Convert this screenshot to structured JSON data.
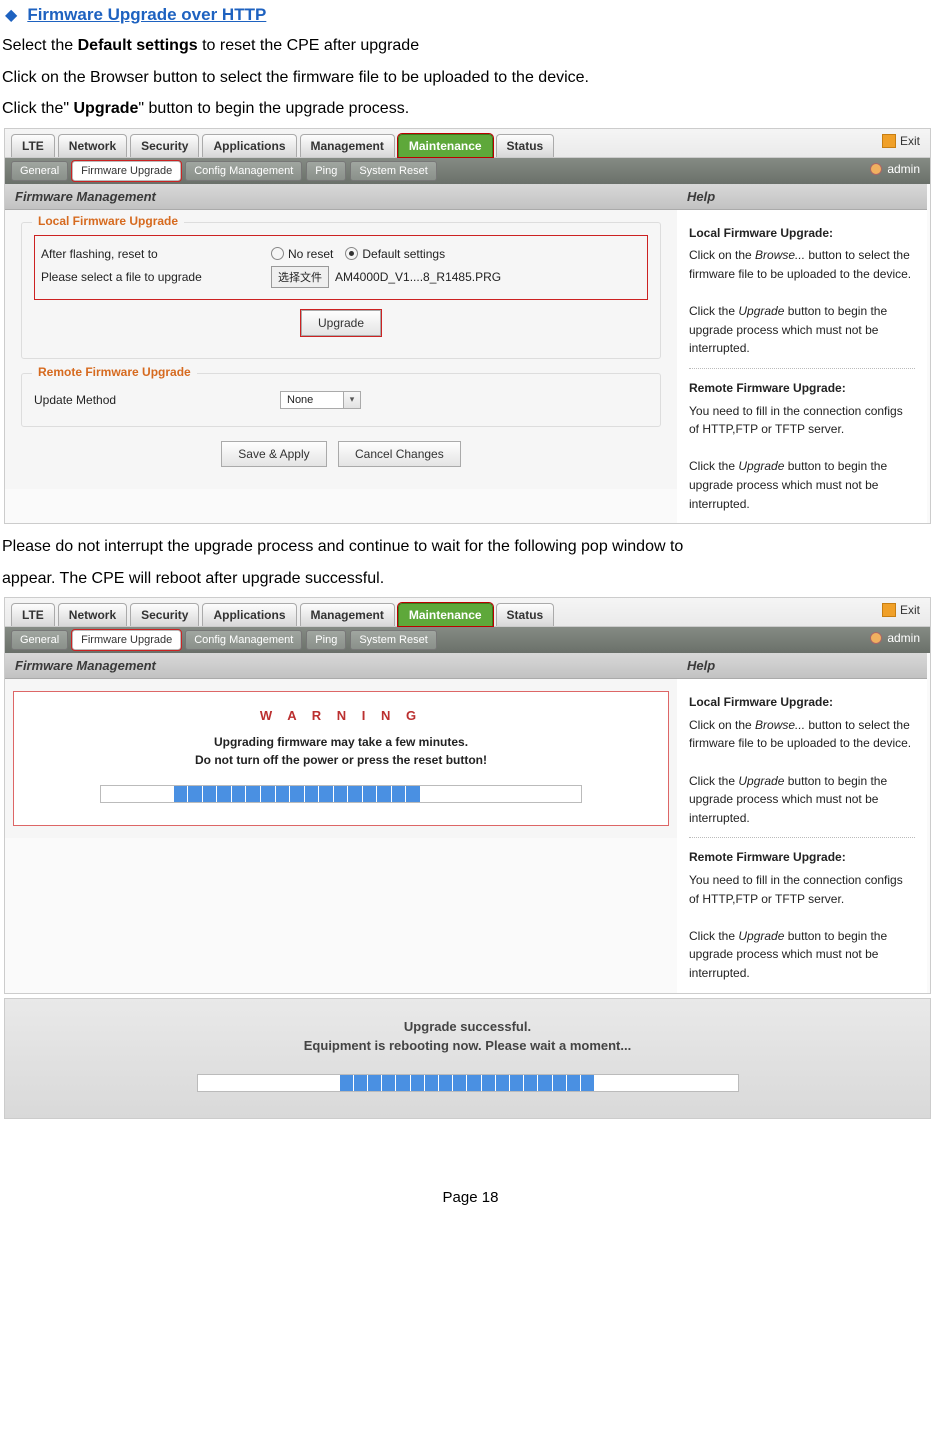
{
  "heading": {
    "title": "Firmware Upgrade over HTTP"
  },
  "doc": {
    "line1a": "Select the ",
    "line1b": "Default settings",
    "line1c": " to reset the CPE after upgrade",
    "line2": "Click on the Browser button to select the firmware file to be uploaded to the device.",
    "line3a": "Click the\" ",
    "line3b": "Upgrade",
    "line3c": "\" button to begin the upgrade process.",
    "mid1": "Please do not interrupt the upgrade process and continue to wait for the following pop window to",
    "mid2": "appear. The CPE will reboot after upgrade successful.",
    "page": "Page 18"
  },
  "main_tabs": [
    "LTE",
    "Network",
    "Security",
    "Applications",
    "Management",
    "Maintenance",
    "Status"
  ],
  "sub_tabs": [
    "General",
    "Firmware Upgrade",
    "Config Management",
    "Ping",
    "System Reset"
  ],
  "exit": "Exit",
  "user": "admin",
  "left_panel_title": "Firmware Management",
  "right_panel_title": "Help",
  "local": {
    "legend": "Local Firmware Upgrade",
    "row1": "After flashing, reset to",
    "row2": "Please select a file to upgrade",
    "opt1": "No reset",
    "opt2": "Default settings",
    "choose": "选择文件",
    "filename": "AM4000D_V1....8_R1485.PRG",
    "upgrade_btn": "Upgrade"
  },
  "remote": {
    "legend": "Remote Firmware Upgrade",
    "row1": "Update Method",
    "value": "None"
  },
  "savebtn": "Save & Apply",
  "cancelbtn": "Cancel Changes",
  "help": {
    "h1": "Local Firmware Upgrade:",
    "p1a": "Click on the ",
    "p1b": "Browse...",
    "p1c": " button to select the firmware file to be uploaded to the device.",
    "p2a": "Click the ",
    "p2b": "Upgrade",
    "p2c": " button to begin the upgrade process which must not be interrupted.",
    "h2": "Remote Firmware Upgrade:",
    "p3": "You need to fill in the connection configs of HTTP,FTP or TFTP server.",
    "p4a": "Click the ",
    "p4b": "Upgrade",
    "p4c": " button to begin the upgrade process which must not be interrupted."
  },
  "warn": {
    "title": "W A R N I N G",
    "l1": "Upgrading firmware may take a few minutes.",
    "l2": "Do not turn off the power or press the reset button!"
  },
  "success": {
    "l1": "Upgrade successful.",
    "l2": "Equipment is rebooting now. Please wait a moment..."
  }
}
